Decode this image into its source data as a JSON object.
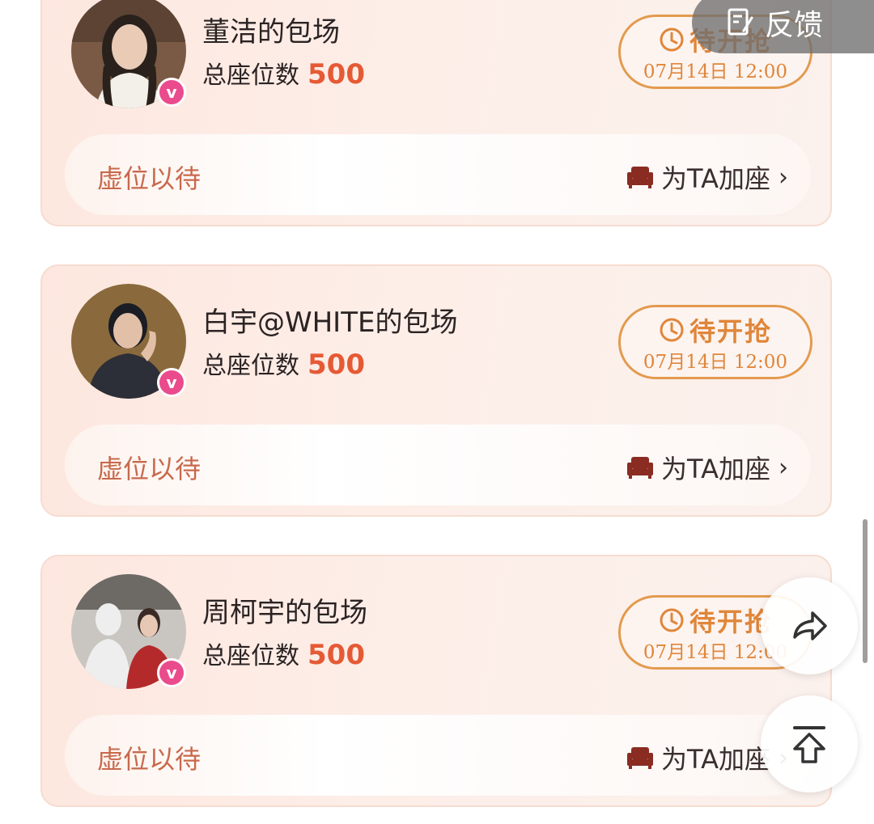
{
  "feedback": {
    "label": "反馈",
    "icon": "feedback-icon"
  },
  "cards": [
    {
      "title": "董洁的包场",
      "seats_label": "总座位数",
      "seats_value": "500",
      "status_label": "待开抢",
      "status_time": "07月14日 12:00",
      "placeholder_text": "虚位以待",
      "add_seat_label": "为TA加座",
      "avatar_colors": [
        "#7a5a45",
        "#2a211c",
        "#e9cbb6",
        "#f3f0ea"
      ]
    },
    {
      "title": "白宇@WHITE的包场",
      "seats_label": "总座位数",
      "seats_value": "500",
      "status_label": "待开抢",
      "status_time": "07月14日 12:00",
      "placeholder_text": "虚位以待",
      "add_seat_label": "为TA加座",
      "avatar_colors": [
        "#8a6a3c",
        "#1b1d25",
        "#e2c0a8",
        "#2c2e38"
      ]
    },
    {
      "title": "周柯宇的包场",
      "seats_label": "总座位数",
      "seats_value": "500",
      "status_label": "待开抢",
      "status_time": "07月14日 12:00",
      "placeholder_text": "虚位以待",
      "add_seat_label": "为TA加座",
      "avatar_colors": [
        "#c9c6c1",
        "#eeeeee",
        "#b42a2a",
        "#3a2a25"
      ]
    }
  ],
  "floating": {
    "share_icon": "share-icon",
    "top_icon": "back-to-top-icon"
  },
  "colors": {
    "accent_orange": "#e0863a",
    "number_red": "#e55a35",
    "verified_pink": "#ea4b8d"
  }
}
